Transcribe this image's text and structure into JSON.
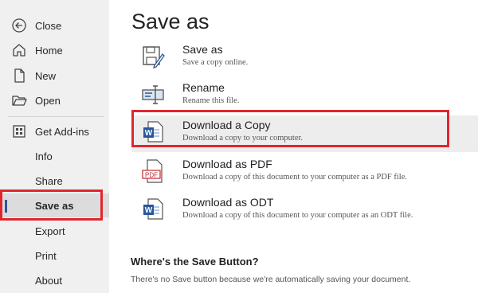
{
  "sidebar": {
    "items": [
      {
        "label": "Close",
        "icon": "back-arrow-icon"
      },
      {
        "label": "Home",
        "icon": "home-icon"
      },
      {
        "label": "New",
        "icon": "new-document-icon"
      },
      {
        "label": "Open",
        "icon": "folder-open-icon"
      },
      {
        "label": "Get Add-ins",
        "icon": "add-ins-icon"
      },
      {
        "label": "Info"
      },
      {
        "label": "Share"
      },
      {
        "label": "Save as",
        "selected": true
      },
      {
        "label": "Export"
      },
      {
        "label": "Print"
      },
      {
        "label": "About"
      }
    ]
  },
  "main": {
    "title": "Save as",
    "options": [
      {
        "title": "Save as",
        "subtitle": "Save a copy online.",
        "icon": "save-as-icon"
      },
      {
        "title": "Rename",
        "subtitle": "Rename this file.",
        "icon": "rename-icon"
      },
      {
        "title": "Download a Copy",
        "subtitle": "Download a copy to your computer.",
        "icon": "word-document-icon",
        "highlighted": true
      },
      {
        "title": "Download as PDF",
        "subtitle": "Download a copy of this document to your computer as a PDF file.",
        "icon": "pdf-icon"
      },
      {
        "title": "Download as ODT",
        "subtitle": "Download a copy of this document to your computer as an ODT file.",
        "icon": "word-document-icon"
      }
    ],
    "help": {
      "title": "Where's the Save Button?",
      "text": "There's no Save button because we're automatically saving your document."
    }
  },
  "colors": {
    "accent": "#2b579a",
    "highlight_border": "#e0262d",
    "sidebar_bg": "#f0f0f0"
  }
}
